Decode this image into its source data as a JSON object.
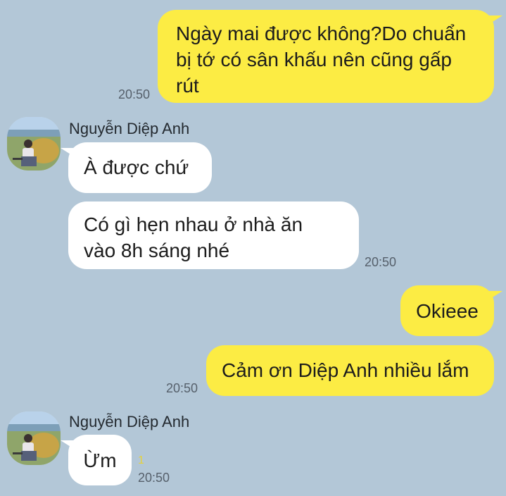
{
  "messages": [
    {
      "text": "Ngày mai được không?Do chuẩn\nbị tớ có sân khấu nên cũng gấp\nrút",
      "time": "20:50"
    },
    {
      "sender": "Nguyễn Diệp Anh",
      "text": "À được chứ"
    },
    {
      "text": "Có gì hẹn nhau ở nhà ăn\nvào 8h sáng nhé",
      "time": "20:50"
    },
    {
      "text": "Okieee"
    },
    {
      "text": "Cảm ơn Diệp Anh nhiều lắm",
      "time": "20:50"
    },
    {
      "sender": "Nguyễn Diệp Anh",
      "text": "Ừm",
      "unread": "1",
      "time": "20:50"
    }
  ],
  "colors": {
    "background": "#b3c7d7",
    "outgoing_bubble": "#fcec44",
    "incoming_bubble": "#ffffff",
    "unread_count": "#e6d23a"
  }
}
